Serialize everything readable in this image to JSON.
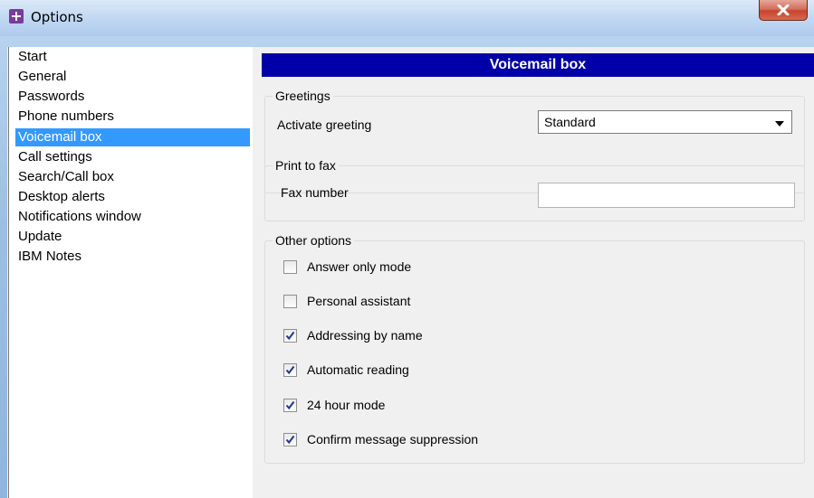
{
  "window": {
    "title": "Options"
  },
  "nav": {
    "items": [
      {
        "label": "Start",
        "selected": false
      },
      {
        "label": "General",
        "selected": false
      },
      {
        "label": "Passwords",
        "selected": false
      },
      {
        "label": "Phone numbers",
        "selected": false
      },
      {
        "label": "Voicemail box",
        "selected": true
      },
      {
        "label": "Call settings",
        "selected": false
      },
      {
        "label": "Search/Call box",
        "selected": false
      },
      {
        "label": "Desktop alerts",
        "selected": false
      },
      {
        "label": "Notifications window",
        "selected": false
      },
      {
        "label": "Update",
        "selected": false
      },
      {
        "label": "IBM Notes",
        "selected": false
      }
    ]
  },
  "panel": {
    "title": "Voicemail box",
    "greetings": {
      "group_title": "Greetings",
      "activate_label": "Activate greeting",
      "activate_value": "Standard"
    },
    "fax": {
      "group_title": "Print to fax",
      "number_label": "Fax number",
      "number_value": ""
    },
    "other": {
      "group_title": "Other options",
      "options": [
        {
          "label": "Answer only mode",
          "checked": false
        },
        {
          "label": "Personal assistant",
          "checked": false
        },
        {
          "label": "Addressing by name",
          "checked": true
        },
        {
          "label": "Automatic reading",
          "checked": true
        },
        {
          "label": "24 hour mode",
          "checked": true
        },
        {
          "label": "Confirm message suppression",
          "checked": true
        }
      ]
    }
  },
  "colors": {
    "header_bg": "#0000a8",
    "selection_bg": "#3399ff",
    "close_button": "#c8452c"
  }
}
